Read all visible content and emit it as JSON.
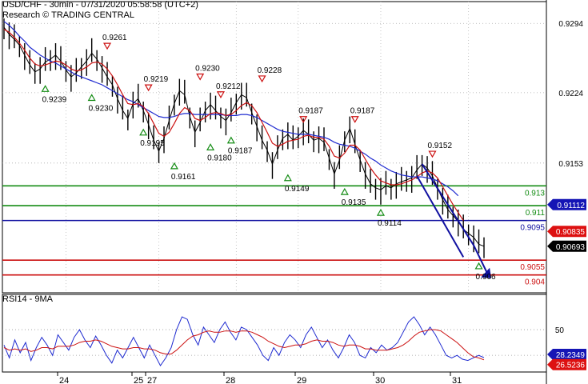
{
  "header": {
    "line1": "USD/CHF - 30min - 07/31/2020 05:58:58 (UTC+2)",
    "line2": "Research © TRADING CENTRAL"
  },
  "chart_data": [
    {
      "type": "line",
      "name": "price-panel",
      "ylim": [
        0.9022,
        0.9316
      ],
      "y_ticks": [
        0.9294,
        0.9224,
        0.9153
      ],
      "x_ticks": [
        "24",
        "25",
        "27",
        "28",
        "29",
        "30",
        "31"
      ],
      "series": [
        {
          "role": "price",
          "color": "#000000",
          "values": [
            0.929,
            0.9283,
            0.9278,
            0.9272,
            0.9262,
            0.9252,
            0.9245,
            0.9248,
            0.9255,
            0.9258,
            0.9262,
            0.9256,
            0.9247,
            0.924,
            0.9244,
            0.925,
            0.9256,
            0.9264,
            0.9258,
            0.9249,
            0.924,
            0.9232,
            0.9218,
            0.9206,
            0.9198,
            0.9213,
            0.9218,
            0.9206,
            0.9192,
            0.9176,
            0.9165,
            0.9178,
            0.9196,
            0.9213,
            0.9226,
            0.9222,
            0.92,
            0.9184,
            0.9194,
            0.9206,
            0.9212,
            0.9206,
            0.92,
            0.9196,
            0.9204,
            0.9214,
            0.9222,
            0.9219,
            0.9204,
            0.919,
            0.9176,
            0.9166,
            0.9152,
            0.9166,
            0.9178,
            0.9182,
            0.9176,
            0.918,
            0.9186,
            0.9182,
            0.9176,
            0.9178,
            0.9174,
            0.9158,
            0.9142,
            0.9156,
            0.9176,
            0.9188,
            0.9172,
            0.9156,
            0.9142,
            0.9132,
            0.9128,
            0.9126,
            0.913,
            0.9128,
            0.9132,
            0.9134,
            0.9136,
            0.9138,
            0.9146,
            0.9152,
            0.9148,
            0.914,
            0.9128,
            0.9116,
            0.9106,
            0.91,
            0.9094,
            0.9086,
            0.9082,
            0.9078,
            0.9071,
            0.9069
          ]
        },
        {
          "role": "slow-moving-average",
          "color": "#1f2bd0",
          "values": [
            0.9296,
            0.9292,
            0.9287,
            0.9281,
            0.9276,
            0.927,
            0.9266,
            0.9262,
            0.9259,
            0.9256,
            0.9254,
            0.9251,
            0.9248,
            0.9245,
            0.9242,
            0.924,
            0.9238,
            0.9236,
            0.9234,
            0.9232,
            0.9229,
            0.9226,
            0.9223,
            0.922,
            0.9217,
            0.9215,
            0.9212,
            0.9209,
            0.9206,
            0.9203,
            0.92,
            0.9199,
            0.9199,
            0.92,
            0.9202,
            0.9203,
            0.9203,
            0.9202,
            0.9202,
            0.9202,
            0.9202,
            0.9202,
            0.9202,
            0.9201,
            0.9201,
            0.9201,
            0.9202,
            0.9202,
            0.9201,
            0.9199,
            0.9196,
            0.9193,
            0.919,
            0.9187,
            0.9185,
            0.9184,
            0.9183,
            0.9182,
            0.9182,
            0.9182,
            0.9181,
            0.918,
            0.9179,
            0.9177,
            0.9174,
            0.9172,
            0.9171,
            0.917,
            0.9168,
            0.9165,
            0.9162,
            0.9158,
            0.9155,
            0.9151,
            0.9148,
            0.9145,
            0.9143,
            0.9141,
            0.914,
            0.9139,
            0.9139,
            0.9139,
            0.9138,
            0.9137,
            0.9135,
            0.9132,
            0.9129,
            0.9125,
            0.912
          ]
        },
        {
          "role": "fast-moving-average",
          "color": "#cc1111",
          "values": [
            0.9288,
            0.9285,
            0.928,
            0.9274,
            0.9267,
            0.9259,
            0.9253,
            0.9251,
            0.9252,
            0.9254,
            0.9256,
            0.9255,
            0.9252,
            0.9248,
            0.9246,
            0.9247,
            0.925,
            0.9254,
            0.9255,
            0.9253,
            0.9248,
            0.9241,
            0.9232,
            0.9222,
            0.9213,
            0.9212,
            0.9213,
            0.921,
            0.9203,
            0.9193,
            0.9183,
            0.918,
            0.9184,
            0.9193,
            0.9203,
            0.9209,
            0.9206,
            0.9198,
            0.9196,
            0.9199,
            0.9203,
            0.9204,
            0.9203,
            0.9201,
            0.9202,
            0.9206,
            0.9211,
            0.9214,
            0.9211,
            0.9204,
            0.9194,
            0.9184,
            0.9173,
            0.917,
            0.9172,
            0.9175,
            0.9176,
            0.9177,
            0.918,
            0.9181,
            0.9179,
            0.9179,
            0.9177,
            0.917,
            0.916,
            0.9158,
            0.9163,
            0.9171,
            0.9171,
            0.9166,
            0.9157,
            0.9148,
            0.9141,
            0.9135,
            0.9133,
            0.9131,
            0.9131,
            0.9132,
            0.9134,
            0.9136,
            0.9139,
            0.9143,
            0.9145,
            0.9143,
            0.9138,
            0.9129,
            0.912,
            0.9111,
            0.9103,
            0.9095
          ]
        }
      ],
      "horizontal_levels": [
        {
          "value": 0.913,
          "label": "0.913",
          "color": "#148c14"
        },
        {
          "value": 0.911,
          "label": "0.911",
          "color": "#148c14"
        },
        {
          "value": 0.9095,
          "label": "0.9095",
          "color": "#1010a0"
        },
        {
          "value": 0.9055,
          "label": "0.9055",
          "color": "#cc1111"
        },
        {
          "value": 0.904,
          "label": "0.904",
          "color": "#cc1111"
        }
      ],
      "price_tags": [
        {
          "value": 0.9111,
          "label": "0.91112",
          "bg": "#1515b5",
          "fg": "#ffffff"
        },
        {
          "value": 0.9084,
          "label": "0.90835",
          "bg": "#dd1111",
          "fg": "#ffffff"
        },
        {
          "value": 0.9069,
          "label": "0.90693",
          "bg": "#000000",
          "fg": "#ffffff"
        }
      ],
      "markers": [
        {
          "label": "0.9261",
          "value": 0.9261,
          "kind": "high"
        },
        {
          "label": "0.9230",
          "value": 0.923,
          "kind": "high"
        },
        {
          "label": "0.9219",
          "value": 0.9219,
          "kind": "high"
        },
        {
          "label": "0.9212",
          "value": 0.9212,
          "kind": "high"
        },
        {
          "label": "0.9228",
          "value": 0.9228,
          "kind": "high"
        },
        {
          "label": "0.9187",
          "value": 0.9187,
          "kind": "high"
        },
        {
          "label": "0.9187",
          "value": 0.9187,
          "kind": "high"
        },
        {
          "label": "0.9152",
          "value": 0.9152,
          "kind": "high"
        },
        {
          "label": "0.9239",
          "value": 0.9239,
          "kind": "low"
        },
        {
          "label": "0.9230",
          "value": 0.923,
          "kind": "low"
        },
        {
          "label": "0.9195",
          "value": 0.9195,
          "kind": "low"
        },
        {
          "label": "0.9161",
          "value": 0.9161,
          "kind": "low"
        },
        {
          "label": "0.9180",
          "value": 0.918,
          "kind": "low"
        },
        {
          "label": "0.9187",
          "value": 0.9187,
          "kind": "low"
        },
        {
          "label": "0.9149",
          "value": 0.9149,
          "kind": "low"
        },
        {
          "label": "0.9135",
          "value": 0.9135,
          "kind": "low"
        },
        {
          "label": "0.9114",
          "value": 0.9114,
          "kind": "low"
        },
        {
          "label": "0.906",
          "value": 0.906,
          "kind": "low"
        }
      ],
      "trend_channel": {
        "upper": [
          [
            0.9152,
            0.907
          ]
        ],
        "lower": [
          [
            0.914,
            0.9058
          ]
        ],
        "arrow_target": 0.904
      }
    },
    {
      "type": "line",
      "name": "rsi-panel",
      "title": "RSI14 - 9MA",
      "ylim": [
        17,
        70
      ],
      "y_ticks": [
        50
      ],
      "reference_levels": [
        50,
        30
      ],
      "series": [
        {
          "role": "rsi",
          "color": "#1f2bd0",
          "values": [
            38,
            28,
            42,
            32,
            40,
            26,
            36,
            44,
            38,
            30,
            46,
            40,
            34,
            44,
            50,
            42,
            36,
            45,
            38,
            30,
            24,
            34,
            28,
            36,
            44,
            36,
            28,
            38,
            30,
            22,
            28,
            36,
            50,
            60,
            58,
            46,
            38,
            52,
            46,
            40,
            50,
            56,
            48,
            42,
            52,
            50,
            44,
            38,
            30,
            26,
            36,
            30,
            40,
            46,
            42,
            36,
            46,
            52,
            44,
            36,
            42,
            34,
            28,
            36,
            46,
            40,
            30,
            28,
            36,
            32,
            38,
            34,
            36,
            40,
            48,
            56,
            60,
            54,
            46,
            52,
            46,
            38,
            30,
            28,
            30,
            27,
            26,
            28,
            30,
            28.2
          ]
        },
        {
          "role": "rsi-ma",
          "color": "#cc1111",
          "values": [
            36,
            34,
            35,
            34,
            35,
            33,
            34,
            36,
            36,
            35,
            37,
            37,
            37,
            38,
            40,
            41,
            41,
            42,
            41,
            39,
            37,
            36,
            35,
            35,
            36,
            36,
            35,
            35,
            34,
            32,
            31,
            31,
            34,
            38,
            42,
            45,
            46,
            48,
            49,
            48,
            48,
            49,
            49,
            48,
            49,
            49,
            48,
            46,
            44,
            41,
            39,
            37,
            36,
            37,
            38,
            38,
            39,
            41,
            42,
            41,
            41,
            40,
            38,
            37,
            38,
            38,
            37,
            35,
            35,
            34,
            34,
            34,
            35,
            36,
            38,
            41,
            45,
            48,
            49,
            50,
            50,
            49,
            46,
            43,
            40,
            36,
            32,
            29,
            28,
            26.5
          ]
        }
      ],
      "price_tags": [
        {
          "value": 28.2349,
          "label": "28.2349",
          "bg": "#1515b5",
          "fg": "#ffffff"
        },
        {
          "value": 26.5236,
          "label": "26.5236",
          "bg": "#dd1111",
          "fg": "#ffffff"
        }
      ]
    }
  ]
}
